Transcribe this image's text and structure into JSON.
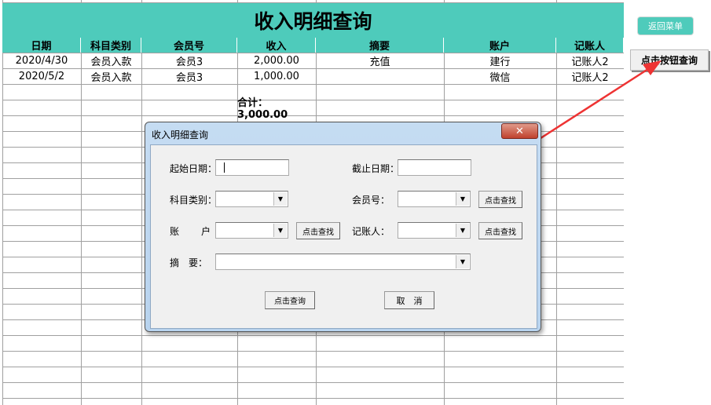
{
  "sheet": {
    "title": "收入明细查询",
    "headers": [
      "日期",
      "科目类别",
      "会员号",
      "收入",
      "摘要",
      "账户",
      "记账人"
    ],
    "rows": [
      [
        "2020/4/30",
        "会员入款",
        "会员3",
        "2,000.00",
        "充值",
        "建行",
        "记账人2"
      ],
      [
        "2020/5/2",
        "会员入款",
        "会员3",
        "1,000.00",
        "",
        "微信",
        "记账人2"
      ]
    ],
    "total": "合计：3,000.00"
  },
  "side": {
    "menu_button": "返回菜单",
    "query_button": "点击按钮查询"
  },
  "dialog": {
    "title": "收入明细查询",
    "close": "✕",
    "start_date_label": "起始日期：",
    "end_date_label": "截止日期：",
    "category_label": "科目类别：",
    "member_label": "会员号：",
    "account_label_a": "账",
    "account_label_b": "户",
    "recorder_label": "记账人：",
    "summary_label": "摘　要：",
    "find_button": "点击查找",
    "query_button": "点击查询",
    "cancel_button": "取　消",
    "start_date": "",
    "end_date": ""
  },
  "colors": {
    "accent": "#4ecbbb",
    "arrow": "#ee3333"
  }
}
